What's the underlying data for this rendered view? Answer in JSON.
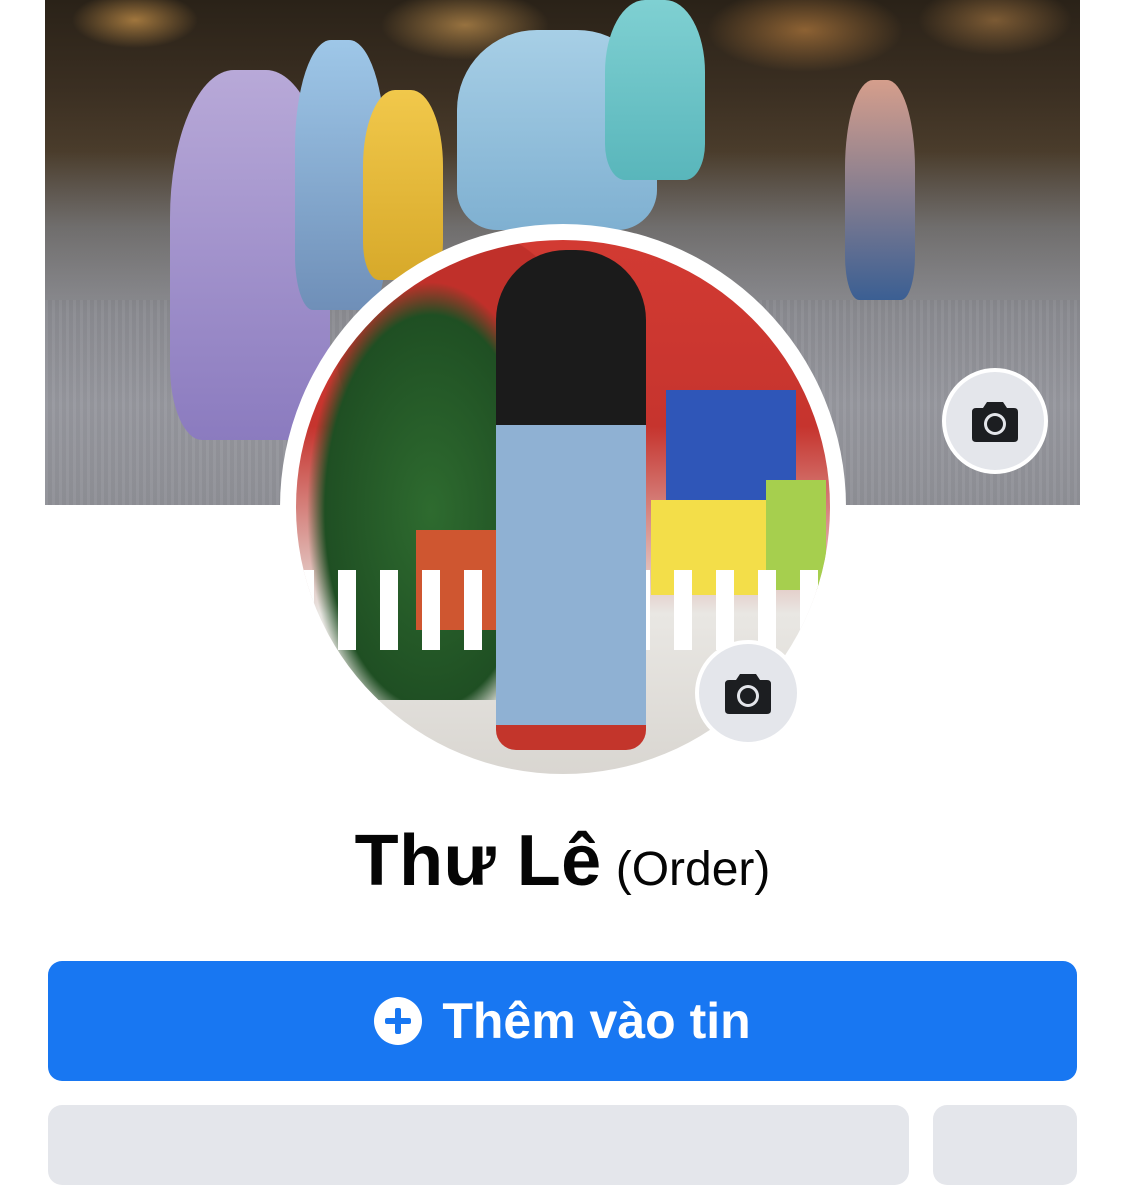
{
  "profile": {
    "name": "Thư Lê",
    "name_suffix": "(Order)"
  },
  "actions": {
    "add_story_label": "Thêm vào tin"
  },
  "icons": {
    "cover_camera": "camera-icon",
    "avatar_camera": "camera-icon",
    "add_story": "plus-circle-icon"
  },
  "colors": {
    "primary": "#1877f2",
    "secondary_button": "#e4e6eb",
    "text": "#050505"
  }
}
